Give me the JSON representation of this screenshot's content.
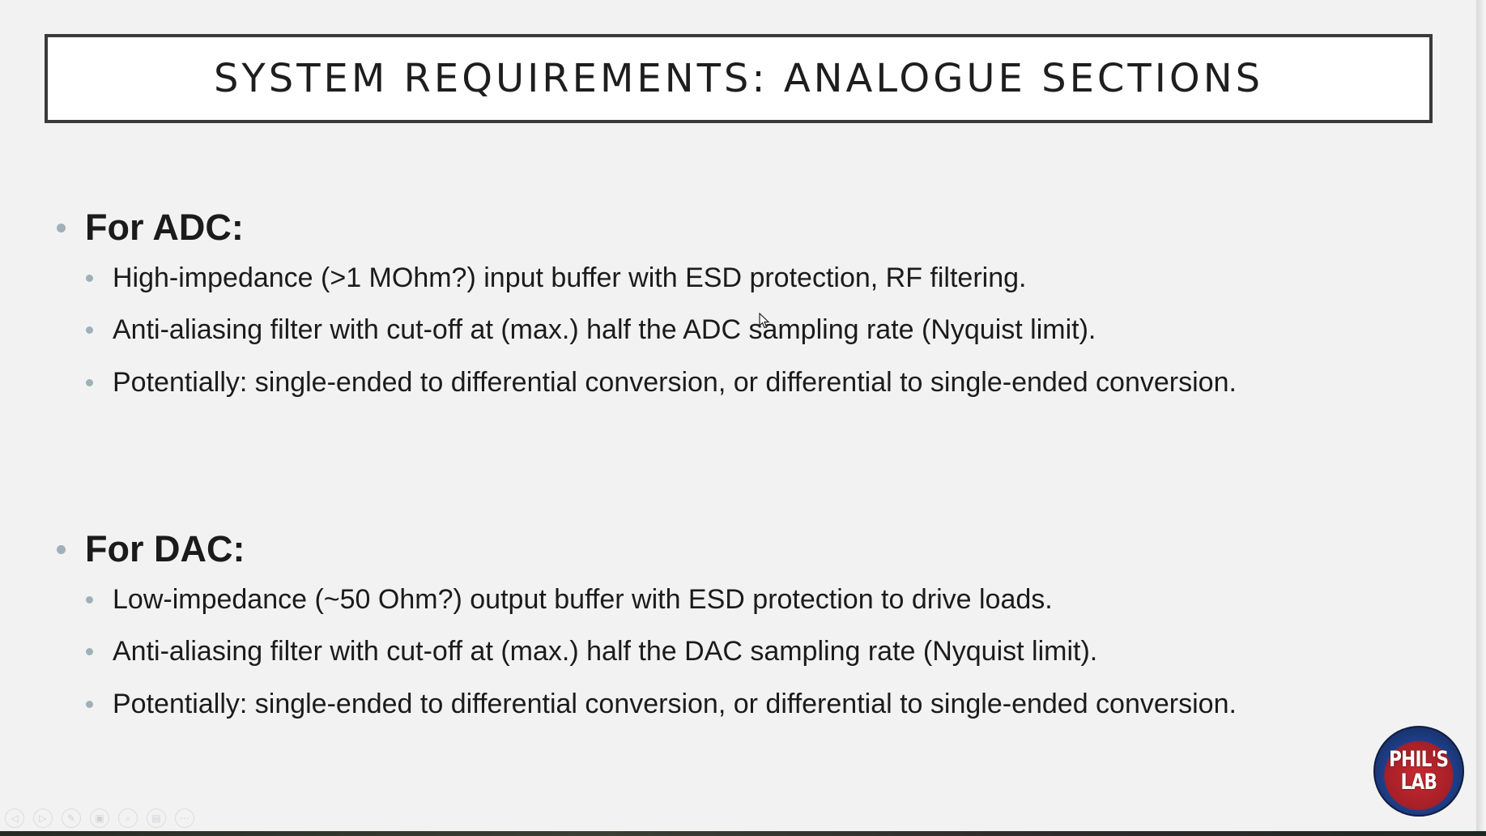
{
  "slide": {
    "title": "SYSTEM REQUIREMENTS: ANALOGUE SECTIONS",
    "sections": [
      {
        "heading": "For ADC:",
        "items": [
          "High-impedance (>1 MOhm?) input buffer with ESD protection, RF filtering.",
          "Anti-aliasing filter with cut-off at (max.) half the ADC sampling rate (Nyquist limit).",
          "Potentially: single-ended to differential conversion, or differential to single-ended conversion."
        ]
      },
      {
        "heading": "For DAC:",
        "items": [
          "Low-impedance (~50 Ohm?) output buffer with ESD protection to drive loads.",
          "Anti-aliasing filter with cut-off at (max.) half the DAC sampling rate (Nyquist limit).",
          "Potentially: single-ended to differential conversion, or differential to single-ended conversion."
        ]
      }
    ]
  },
  "logo": {
    "line1": "PHIL'S",
    "line2": "LAB"
  },
  "controls": [
    {
      "name": "previous-slide-icon",
      "glyph": "◁"
    },
    {
      "name": "next-slide-icon",
      "glyph": "▷"
    },
    {
      "name": "pen-icon",
      "glyph": "✎"
    },
    {
      "name": "slides-icon",
      "glyph": "▣"
    },
    {
      "name": "zoom-icon",
      "glyph": "⌕"
    },
    {
      "name": "subtitles-icon",
      "glyph": "▤"
    },
    {
      "name": "more-options-icon",
      "glyph": "⋯"
    }
  ],
  "colors": {
    "bullet": "#9fb0b8",
    "text": "#1b1b1b",
    "background": "#f2f2f2",
    "logo_red": "#c62a2f",
    "logo_blue": "#1c3e8a"
  }
}
